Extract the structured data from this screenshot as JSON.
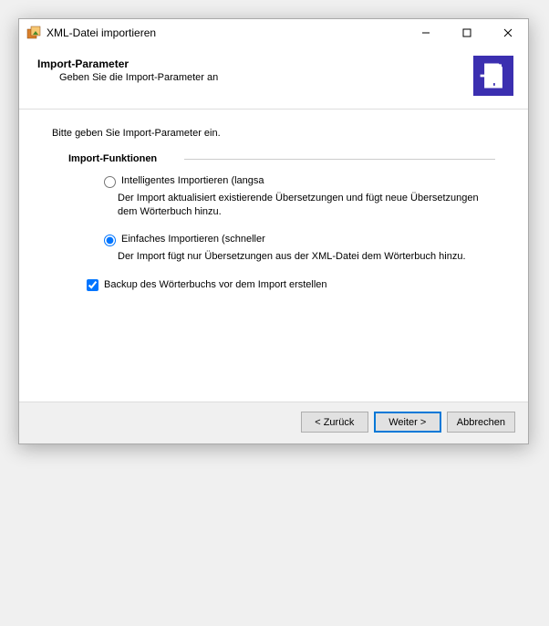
{
  "titlebar": {
    "title": "XML-Datei importieren"
  },
  "header": {
    "title": "Import-Parameter",
    "subtitle": "Geben Sie die Import-Parameter an"
  },
  "content": {
    "intro": "Bitte geben Sie Import-Parameter ein.",
    "section": "Import-Funktionen",
    "option1": {
      "label": "Intelligentes Importieren (langsa",
      "desc": "Der Import aktualisiert existierende Übersetzungen und fügt neue Übersetzungen dem Wörterbuch hinzu."
    },
    "option2": {
      "label": "Einfaches Importieren (schneller",
      "desc": "Der Import fügt nur Übersetzungen aus der XML-Datei dem Wörterbuch hinzu."
    },
    "backup": "Backup des Wörterbuchs vor dem Import erstellen"
  },
  "footer": {
    "back": "< Zurück",
    "next": "Weiter >",
    "cancel": "Abbrechen"
  }
}
